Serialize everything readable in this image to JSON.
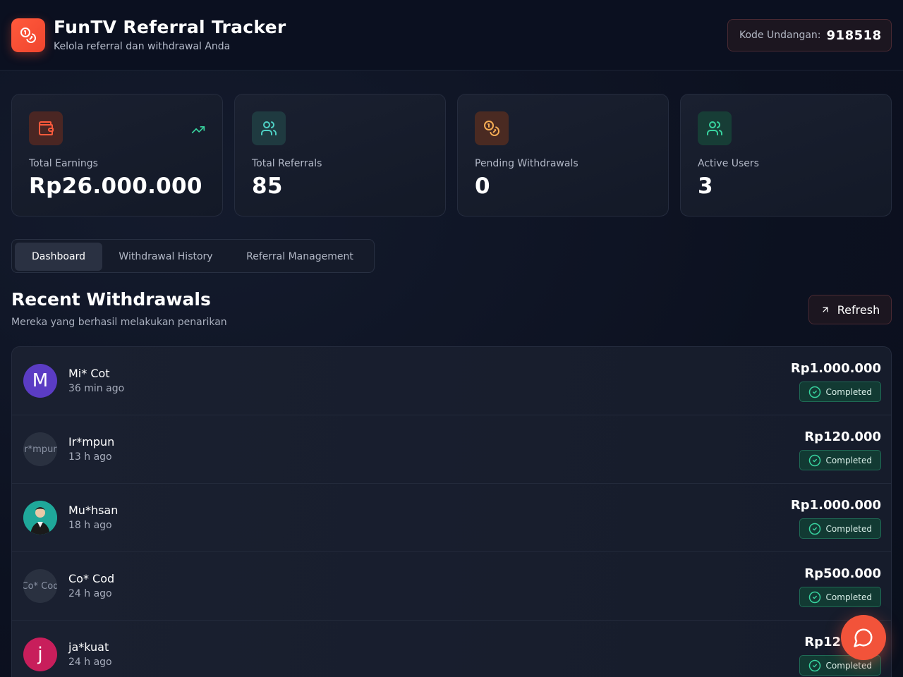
{
  "header": {
    "title": "FunTV Referral Tracker",
    "subtitle": "Kelola referral dan withdrawal Anda",
    "invite_label": "Kode Undangan:",
    "invite_code": "918518",
    "logo_icon": "coins-icon"
  },
  "stats": [
    {
      "label": "Total Earnings",
      "value": "Rp26.000.000",
      "icon": "wallet-icon",
      "color": "#ff5a3c"
    },
    {
      "label": "Total Referrals",
      "value": "85",
      "icon": "users-icon",
      "color": "#4fd1c5"
    },
    {
      "label": "Pending Withdrawals",
      "value": "0",
      "icon": "coins-icon",
      "color": "#f6ad55"
    },
    {
      "label": "Active Users",
      "value": "3",
      "icon": "users-icon",
      "color": "#38d39f"
    }
  ],
  "tabs": [
    {
      "label": "Dashboard",
      "active": true
    },
    {
      "label": "Withdrawal History",
      "active": false
    },
    {
      "label": "Referral Management",
      "active": false
    }
  ],
  "section": {
    "title": "Recent Withdrawals",
    "subtitle": "Mereka yang berhasil melakukan penarikan",
    "refresh_label": "Refresh"
  },
  "withdrawals": [
    {
      "initial": "M",
      "avatar_type": "letter",
      "avatar_color": "#5b3cc4",
      "name": "Mi* Cot",
      "time": "36 min ago",
      "amount": "Rp1.000.000",
      "status": "Completed"
    },
    {
      "initial": "",
      "avatar_type": "image-alt",
      "avatar_alt": "Ir*mpun",
      "avatar_color": "#2a3140",
      "name": "Ir*mpun",
      "time": "13 h ago",
      "amount": "Rp120.000",
      "status": "Completed"
    },
    {
      "initial": "",
      "avatar_type": "photo",
      "avatar_color": "#1fa89a",
      "name": "Mu*hsan",
      "time": "18 h ago",
      "amount": "Rp1.000.000",
      "status": "Completed"
    },
    {
      "initial": "",
      "avatar_type": "image-alt",
      "avatar_alt": "Co* Cod",
      "avatar_color": "#2a3140",
      "name": "Co* Cod",
      "time": "24 h ago",
      "amount": "Rp500.000",
      "status": "Completed"
    },
    {
      "initial": "j",
      "avatar_type": "letter",
      "avatar_color": "#c81e5b",
      "name": "ja*kuat",
      "time": "24 h ago",
      "amount": "Rp120.000",
      "status": "Completed"
    }
  ],
  "colors": {
    "accent": "#f2533a",
    "success": "#38d39f"
  }
}
